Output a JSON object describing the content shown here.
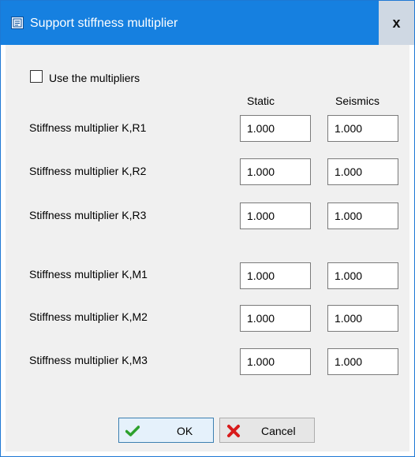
{
  "window": {
    "title": "Support stiffness multiplier",
    "close_label": "x"
  },
  "options": {
    "use_multipliers_label": "Use the multipliers",
    "use_multipliers_checked": false
  },
  "columns": {
    "static": "Static",
    "seismics": "Seismics"
  },
  "rows": [
    {
      "label": "Stiffness multiplier K,R1",
      "static": "1.000",
      "seismics": "1.000"
    },
    {
      "label": "Stiffness multiplier K,R2",
      "static": "1.000",
      "seismics": "1.000"
    },
    {
      "label": "Stiffness multiplier K,R3",
      "static": "1.000",
      "seismics": "1.000"
    },
    {
      "label": "Stiffness multiplier K,M1",
      "static": "1.000",
      "seismics": "1.000"
    },
    {
      "label": "Stiffness multiplier K,M2",
      "static": "1.000",
      "seismics": "1.000"
    },
    {
      "label": "Stiffness multiplier K,M3",
      "static": "1.000",
      "seismics": "1.000"
    }
  ],
  "buttons": {
    "ok": "OK",
    "cancel": "Cancel",
    "ok_icon": "checkmark-icon",
    "cancel_icon": "red-x-icon"
  },
  "colors": {
    "titlebar": "#1680e0",
    "content_bg": "#f0f0f0"
  }
}
